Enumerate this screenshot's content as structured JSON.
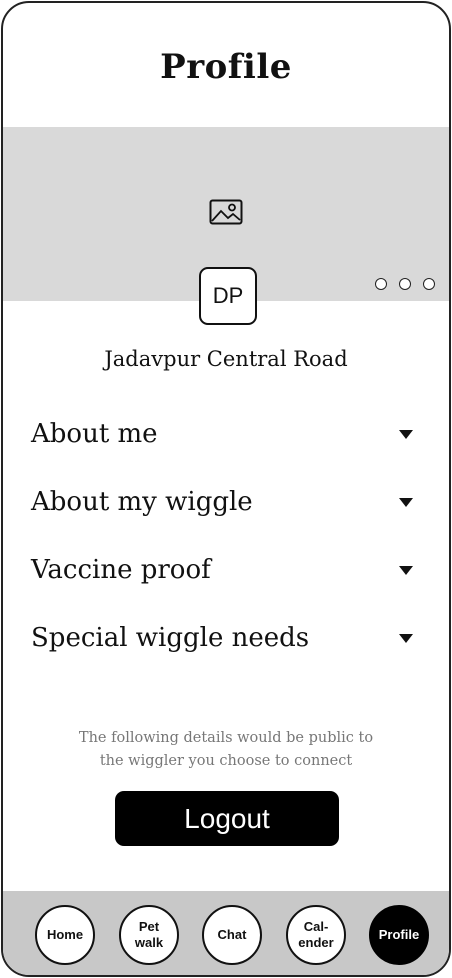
{
  "header": {
    "title": "Profile"
  },
  "cover": {
    "icon": "image-icon"
  },
  "carousel": {
    "dots": 3,
    "icon": "more-dots-icon"
  },
  "avatar": {
    "initials": "DP"
  },
  "location": {
    "text": "Jadavpur Central Road"
  },
  "sections": [
    {
      "label": "About me",
      "icon": "caret-down-icon"
    },
    {
      "label": "About my wiggle",
      "icon": "caret-down-icon"
    },
    {
      "label": "Vaccine proof",
      "icon": "caret-down-icon"
    },
    {
      "label": "Special wiggle needs",
      "icon": "caret-down-icon"
    }
  ],
  "public_note": {
    "line1": "The following details would be public to",
    "line2": "the wiggler you choose to connect"
  },
  "logout": {
    "label": "Logout"
  },
  "nav": {
    "items": [
      {
        "label": "Home",
        "active": false
      },
      {
        "label": "Pet\nwalk",
        "active": false
      },
      {
        "label": "Chat",
        "active": false
      },
      {
        "label": "Cal-\nender",
        "active": false
      },
      {
        "label": "Profile",
        "active": true
      }
    ]
  },
  "colors": {
    "cover_bg": "#d9d9d9",
    "nav_bg": "#c8c8c8",
    "primary": "#000000",
    "note_text": "#777777"
  }
}
